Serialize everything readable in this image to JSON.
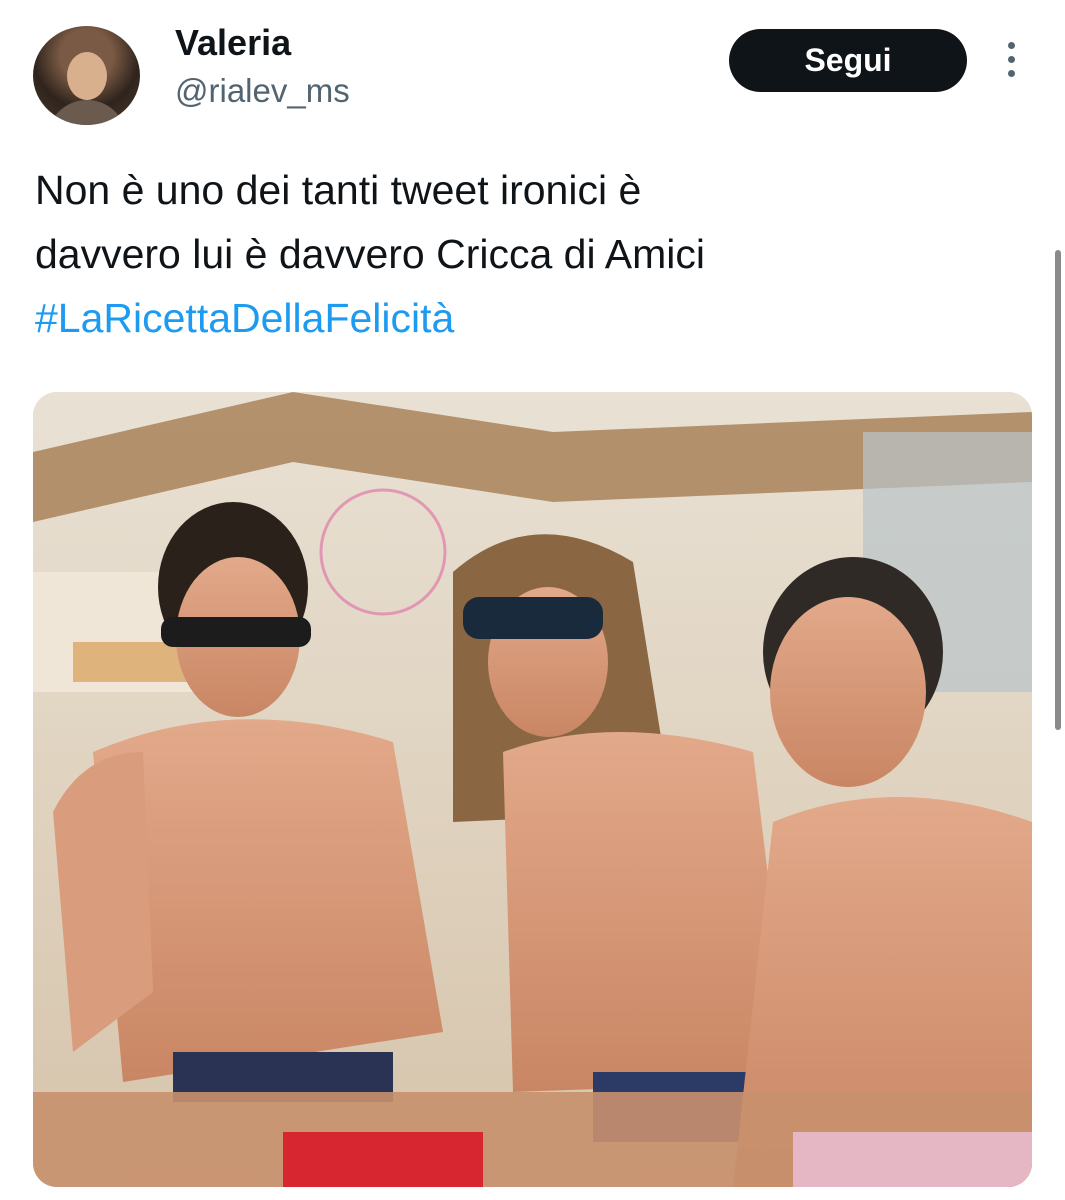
{
  "author": {
    "name": "Valeria",
    "handle": "@rialev_ms"
  },
  "follow_label": "Segui",
  "tweet": {
    "line1": "Non è uno dei tanti tweet ironici è",
    "line2": "davvero lui è davvero Cricca di Amici",
    "hashtag": "#LaRicettaDellaFelicità"
  },
  "colors": {
    "hashtag": "#1d9bf0",
    "follow_bg": "#0f1419",
    "secondary_text": "#536471"
  },
  "icons": {
    "more": "more-vertical-icon"
  }
}
